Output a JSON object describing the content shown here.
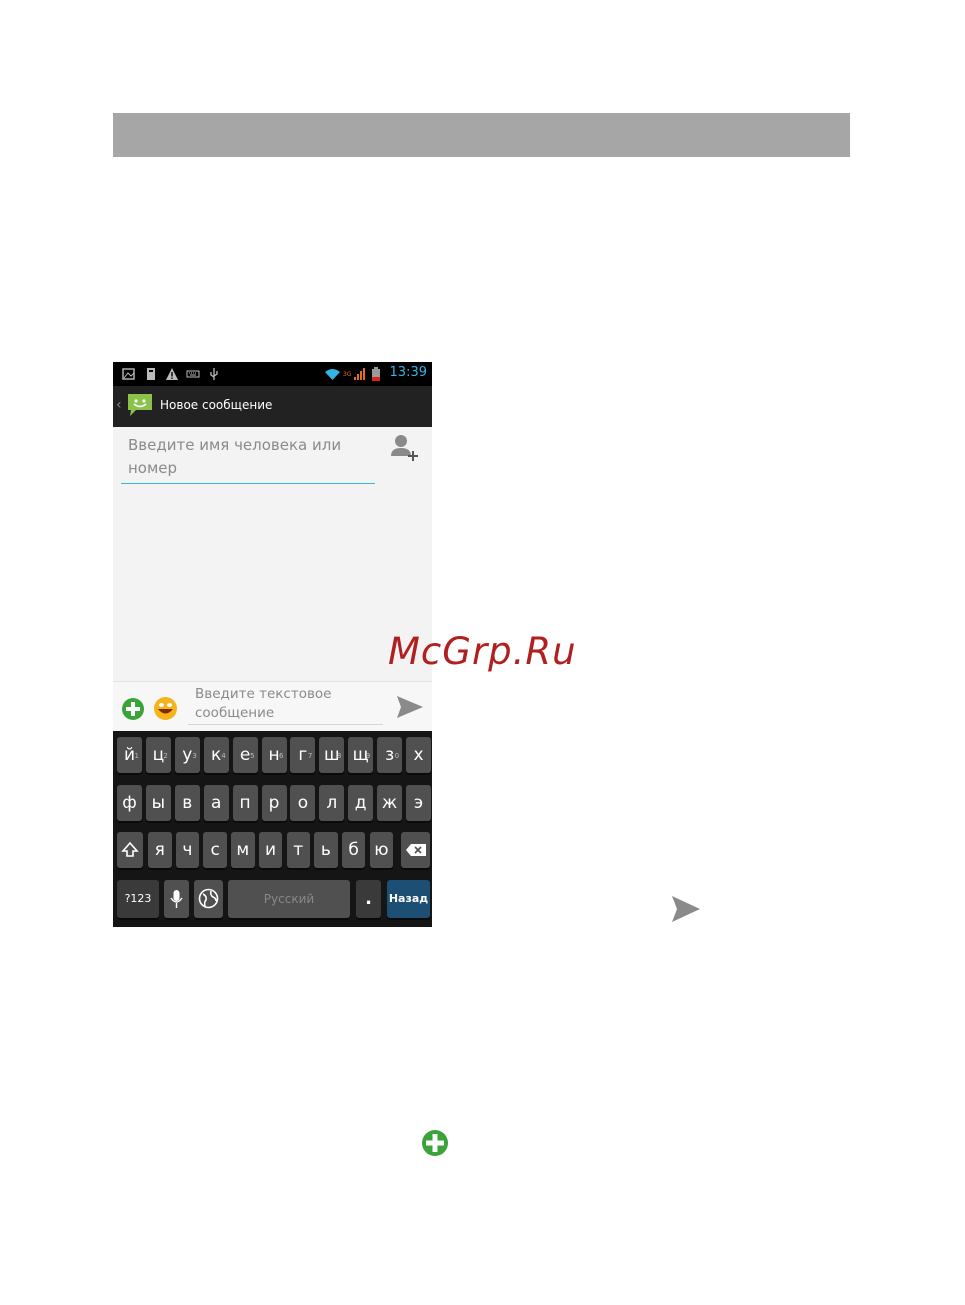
{
  "status_bar": {
    "time": "13:39"
  },
  "action_bar": {
    "title": "Новое сообщение"
  },
  "recipient": {
    "placeholder": "Введите имя человека или номер"
  },
  "compose": {
    "placeholder": "Введите текстовое сообщение"
  },
  "keyboard": {
    "row1": [
      {
        "label": "й",
        "hint": "1"
      },
      {
        "label": "ц",
        "hint": "2"
      },
      {
        "label": "у",
        "hint": "3"
      },
      {
        "label": "к",
        "hint": "4"
      },
      {
        "label": "е",
        "hint": "5"
      },
      {
        "label": "н",
        "hint": "6"
      },
      {
        "label": "г",
        "hint": "7"
      },
      {
        "label": "ш",
        "hint": "8"
      },
      {
        "label": "щ",
        "hint": "9"
      },
      {
        "label": "з",
        "hint": "0"
      },
      {
        "label": "х",
        "hint": ""
      }
    ],
    "row2": [
      "ф",
      "ы",
      "в",
      "а",
      "п",
      "р",
      "о",
      "л",
      "д",
      "ж",
      "э"
    ],
    "row3": [
      "я",
      "ч",
      "с",
      "м",
      "и",
      "т",
      "ь",
      "б",
      "ю"
    ],
    "symbols_label": "?123",
    "space_label": "Русский",
    "period_label": ".",
    "enter_label": "Назад"
  },
  "watermark": "McGrp.Ru",
  "colors": {
    "accent": "#33b5e5",
    "enter_key": "#1d4e74",
    "header_band": "#a6a6a6",
    "watermark": "#b02020"
  }
}
